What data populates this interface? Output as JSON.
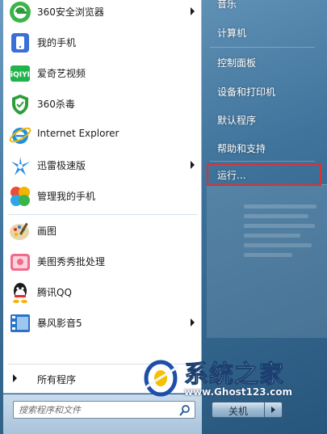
{
  "programs": [
    {
      "label": "360安全浏览器",
      "icon": "360-browser-icon",
      "submenu": true
    },
    {
      "label": "我的手机",
      "icon": "my-phone-icon",
      "submenu": false
    },
    {
      "label": "爱奇艺视频",
      "icon": "iqiyi-icon",
      "submenu": false
    },
    {
      "label": "360杀毒",
      "icon": "360-antivirus-icon",
      "submenu": false
    },
    {
      "label": "Internet Explorer",
      "icon": "ie-icon",
      "submenu": false
    },
    {
      "label": "迅雷极速版",
      "icon": "xunlei-icon",
      "submenu": true
    },
    {
      "label": "管理我的手机",
      "icon": "manage-phone-icon",
      "submenu": false
    },
    {
      "label": "画图",
      "icon": "paint-icon",
      "submenu": false
    },
    {
      "label": "美图秀秀批处理",
      "icon": "meitu-icon",
      "submenu": false
    },
    {
      "label": "腾讯QQ",
      "icon": "qq-icon",
      "submenu": false
    },
    {
      "label": "暴风影音5",
      "icon": "baofeng-icon",
      "submenu": true
    }
  ],
  "all_programs": "所有程序",
  "search": {
    "placeholder": "搜索程序和文件"
  },
  "right_items": [
    {
      "label": "音乐"
    },
    {
      "label": "计算机"
    },
    {
      "label": "控制面板"
    },
    {
      "label": "设备和打印机"
    },
    {
      "label": "默认程序"
    },
    {
      "label": "帮助和支持"
    },
    {
      "label": "运行...",
      "highlighted": true,
      "highlight_color": "#e0302e"
    }
  ],
  "shutdown": {
    "label": "关机"
  },
  "watermark": {
    "title": "系统之家",
    "url": "www.Ghost123.com"
  }
}
